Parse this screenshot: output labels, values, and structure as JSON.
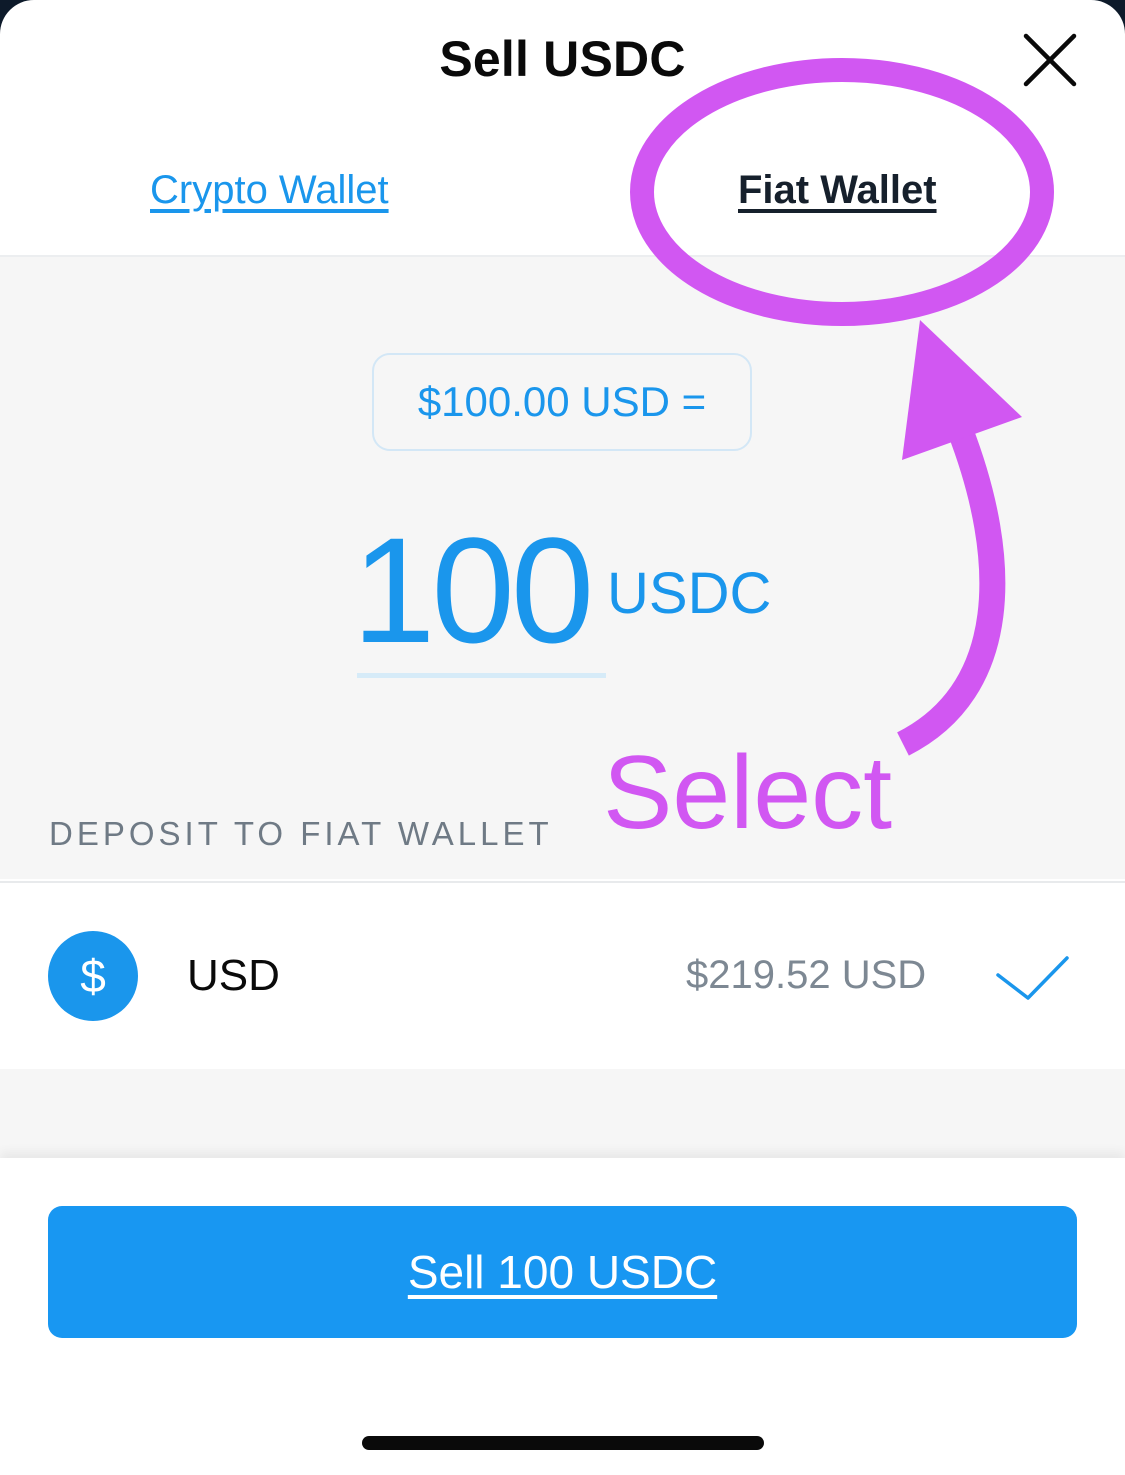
{
  "header": {
    "title": "Sell USDC",
    "close_icon": "close-icon"
  },
  "tabs": [
    {
      "label": "Crypto Wallet",
      "active": false
    },
    {
      "label": "Fiat Wallet",
      "active": true
    }
  ],
  "conversion": {
    "rate_label": "$100.00 USD =",
    "amount": "100",
    "unit": "USDC"
  },
  "deposit": {
    "section_label": "DEPOSIT TO FIAT WALLET",
    "wallet": {
      "icon_symbol": "$",
      "name": "USD",
      "balance": "$219.52 USD",
      "selected": true
    }
  },
  "footer": {
    "sell_label": "Sell 100 USDC"
  },
  "annotation": {
    "text": "Select",
    "color": "#d157f2"
  },
  "colors": {
    "accent": "#1a96ec",
    "button": "#1897f2",
    "annotation": "#d157f2"
  }
}
